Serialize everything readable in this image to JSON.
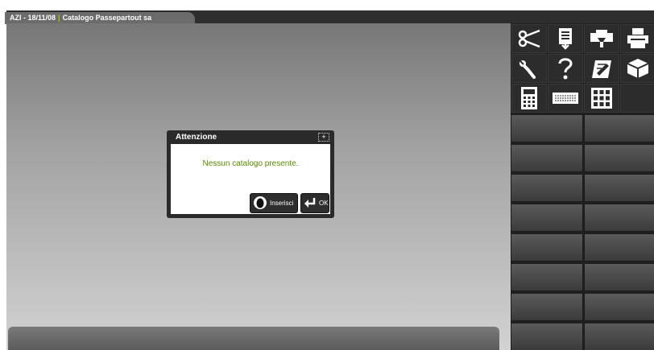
{
  "tab": {
    "part1": "AZI - 18/11/08",
    "separator": "|",
    "part2": "Catalogo Passepartout sa"
  },
  "dialog": {
    "title": "Attenzione",
    "expand_symbol": "+",
    "message": "Nessun catalogo presente.",
    "buttons": {
      "insert_label": "Inserisci",
      "ok_label": "OK"
    }
  },
  "toolbar": {
    "icons": [
      "scissors-icon",
      "paste-icon",
      "print-preview-icon",
      "printer-icon",
      "wrench-icon",
      "help-icon",
      "edit-document-icon",
      "package-icon",
      "calculator-icon",
      "keyboard-icon",
      "grid-icon"
    ]
  },
  "colors": {
    "accent": "#9fd000",
    "message_text": "#5a8a00",
    "panel_bg": "#202020"
  }
}
